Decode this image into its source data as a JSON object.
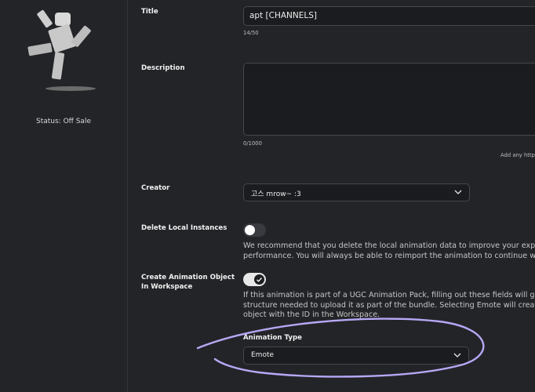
{
  "sidebar": {
    "status_text": "Status: Off Sale"
  },
  "form": {
    "title": {
      "label": "Title",
      "value": "apt [CHANNELS]",
      "counter": "14/50"
    },
    "description": {
      "label": "Description",
      "value": "",
      "counter": "0/1000",
      "hint": "Add any http"
    },
    "creator": {
      "label": "Creator",
      "value": "고스 mrow~ :3"
    },
    "delete_local": {
      "label": "Delete Local Instances",
      "toggle_on": false,
      "help": [
        "We recommend that you delete the local animation data to improve your experien",
        "performance. You will always be able to reimport the animation to continue worki"
      ]
    },
    "create_object": {
      "label": "Create Animation Object In Workspace",
      "toggle_on": true,
      "help": [
        "If this animation is part of a UGC Animation Pack, filling out these fields will gener",
        "structure needed to upload it as part of the bundle. Selecting Emote will create th",
        "object with the ID in the Workspace."
      ]
    },
    "animation_type": {
      "label": "Animation Type",
      "value": "Emote"
    }
  },
  "colors": {
    "background": "#232428",
    "annotation_stroke": "#b7a8f5"
  },
  "icons": {
    "dropdown": "chevron-down-icon",
    "check": "check-icon",
    "avatar": "animation-thumbnail"
  }
}
